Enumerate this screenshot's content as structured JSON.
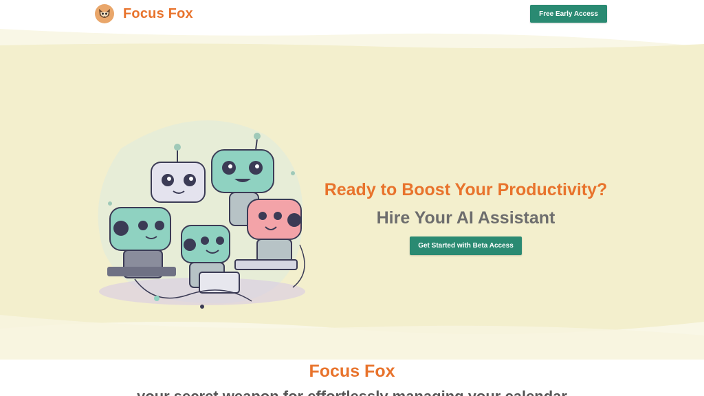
{
  "header": {
    "brand_name": "Focus Fox",
    "logo_icon": "fox-logo-icon",
    "cta_label": "Free Early Access"
  },
  "hero": {
    "headline": "Ready to Boost Your Productivity?",
    "subhead": "Hire Your AI Assistant",
    "cta_label": "Get Started with Beta Access",
    "illustration": "robots-illustration"
  },
  "section": {
    "title": "Focus Fox",
    "subtitle": "your secret weapon for effortlessly managing your calendar"
  },
  "colors": {
    "accent": "#e8732c",
    "button": "#2a8a72",
    "hero_bg": "#f3efcd",
    "heading_gray": "#6d6d6d"
  }
}
